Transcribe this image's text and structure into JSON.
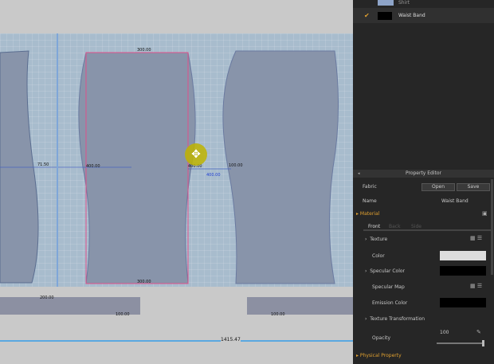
{
  "canvas": {
    "labels": {
      "top_width": "300.00",
      "bottom_width": "300.00",
      "side_left": "71.50",
      "mid_left": "400.00",
      "mid_right": "400.00",
      "right_left": "100.00",
      "blue_measure": "400.00",
      "strip_left": "200.00",
      "strip_left_bottom": "100.00",
      "strip_right": "100.00",
      "total": "1415.47"
    }
  },
  "objects": {
    "items": [
      {
        "label": "Shirt",
        "checked": false
      },
      {
        "label": "Waist Band",
        "checked": true,
        "swatch": "#000000"
      }
    ]
  },
  "property_editor": {
    "title": "Property Editor",
    "fabric_label": "Fabric",
    "open_label": "Open",
    "save_label": "Save",
    "name_label": "Name",
    "name_value": "Waist Band",
    "material_label": "Material",
    "tabs": [
      "Front",
      "Back",
      "Side"
    ],
    "texture_label": "Texture",
    "color_label": "Color",
    "color_value": "#dcdcdc",
    "specular_color_label": "Specular Color",
    "specular_color_value": "#000000",
    "specular_map_label": "Specular Map",
    "emission_color_label": "Emission Color",
    "emission_color_value": "#000000",
    "texture_transformation_label": "Texture Transformation",
    "opacity_label": "Opacity",
    "opacity_value": "100",
    "physical_property_label": "Physical Property"
  },
  "colors": {
    "accent": "#e0a030",
    "pattern": "#8894aa",
    "seam": "#e0508a"
  }
}
